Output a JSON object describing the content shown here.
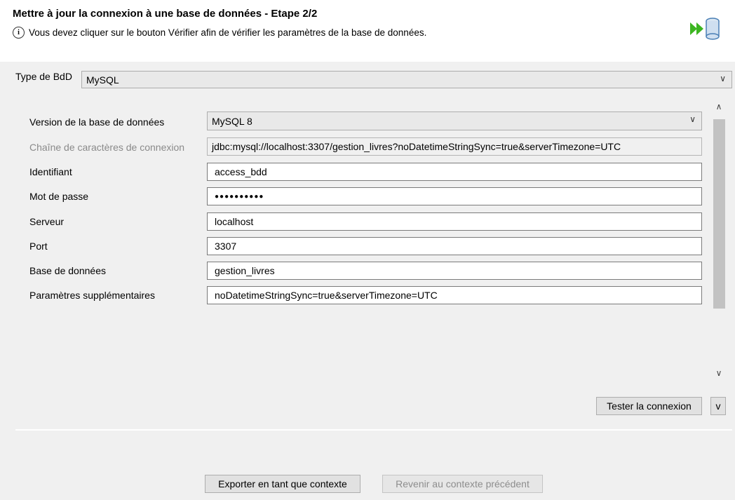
{
  "header": {
    "title": "Mettre à jour la connexion à une base de données - Etape 2/2",
    "info_glyph": "i",
    "message": "Vous devez cliquer sur le bouton Vérifier afin de vérifier les paramètres de la base de données."
  },
  "db_type": {
    "label": "Type de BdD",
    "value": "MySQL"
  },
  "form": {
    "version": {
      "label": "Version de la base de données",
      "value": "MySQL 8"
    },
    "connection_string": {
      "label": "Chaîne de caractères de connexion",
      "value": "jdbc:mysql://localhost:3307/gestion_livres?noDatetimeStringSync=true&serverTimezone=UTC"
    },
    "login": {
      "label": "Identifiant",
      "value": "access_bdd"
    },
    "password": {
      "label": "Mot de passe",
      "value": "●●●●●●●●●●"
    },
    "server": {
      "label": "Serveur",
      "value": "localhost"
    },
    "port": {
      "label": "Port",
      "value": "3307"
    },
    "database": {
      "label": "Base de données",
      "value": "gestion_livres"
    },
    "extra_params": {
      "label": "Paramètres supplémentaires",
      "value": "noDatetimeStringSync=true&serverTimezone=UTC"
    }
  },
  "buttons": {
    "test_connection": "Tester la connexion",
    "toggle": "v",
    "export_context": "Exporter en tant que contexte",
    "revert_context": "Revenir au contexte précédent"
  },
  "icons": {
    "info": "info-icon",
    "wizard": "database-arrow-icon",
    "dropdown": "chevron-down-icon",
    "scroll_up": "chevron-up-icon",
    "scroll_down": "chevron-down-icon"
  },
  "colors": {
    "wizard_arrow": "#3cb521",
    "wizard_cylinder": "#4a7fb5"
  }
}
